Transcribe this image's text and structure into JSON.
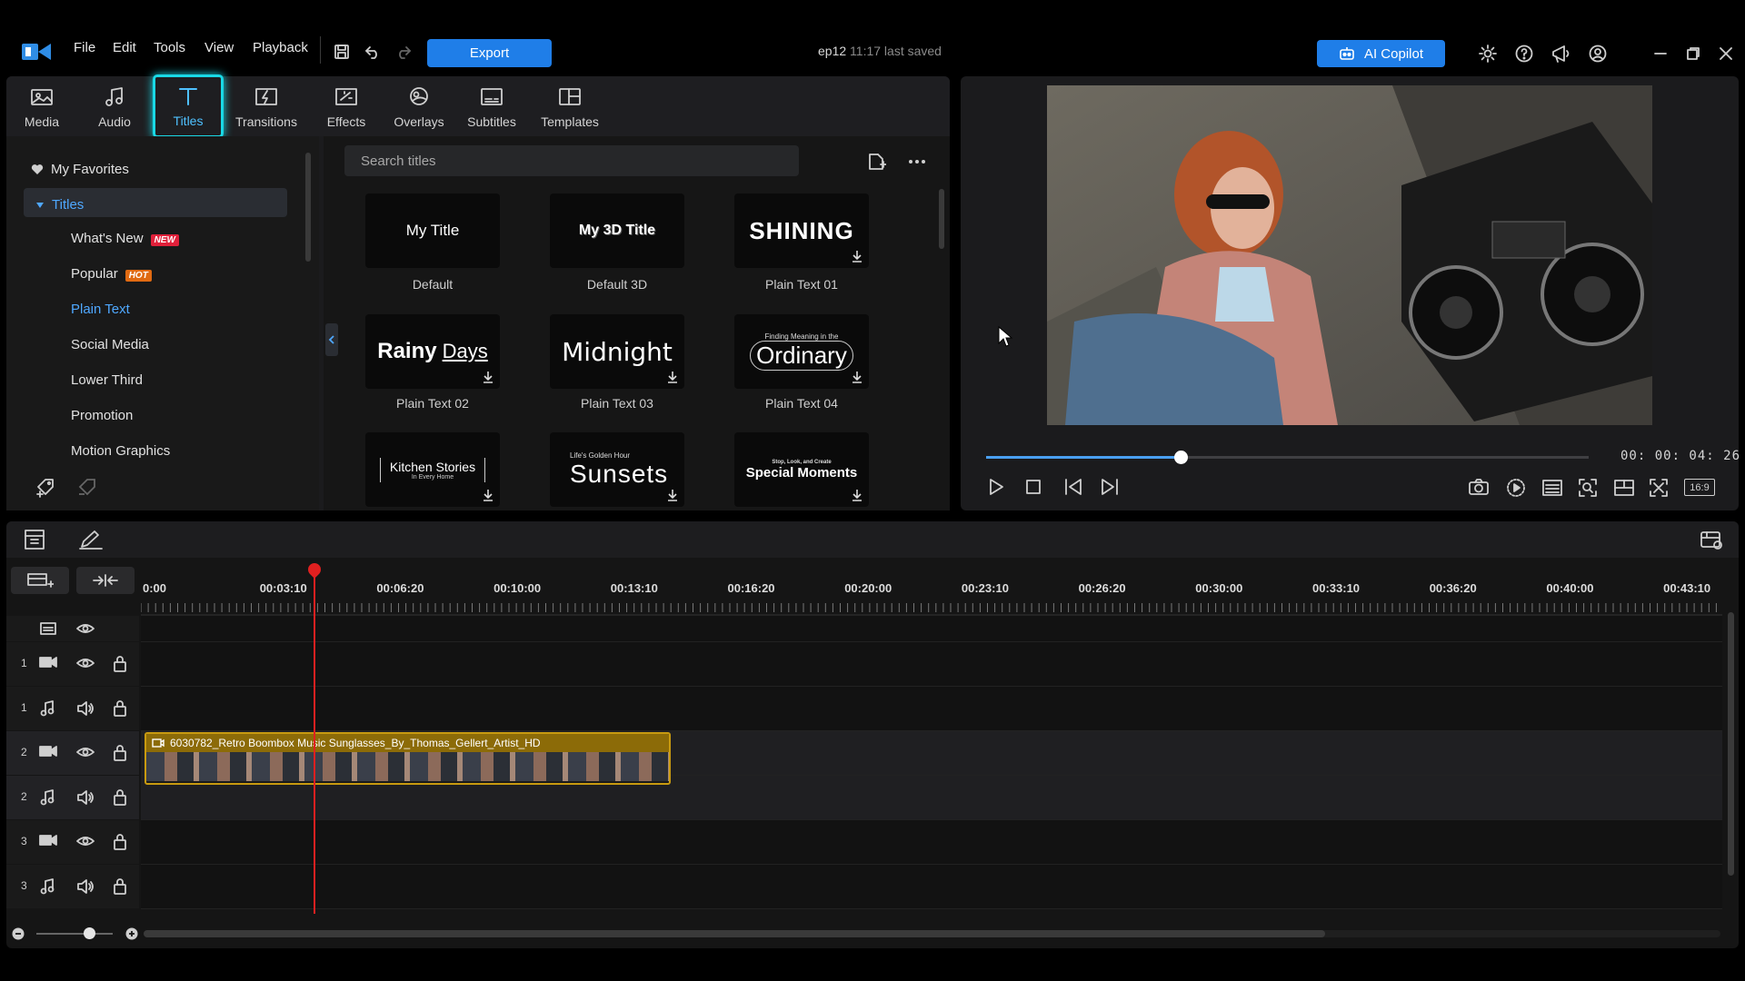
{
  "menu": {
    "items": [
      "File",
      "Edit",
      "Tools",
      "View",
      "Playback"
    ],
    "export_label": "Export",
    "project_name": "ep12",
    "project_status": "11:17 last saved",
    "ai_copilot_label": "AI Copilot"
  },
  "tabs": [
    {
      "label": "Media",
      "icon": "media-icon"
    },
    {
      "label": "Audio",
      "icon": "music-note-icon"
    },
    {
      "label": "Titles",
      "icon": "title-t-icon",
      "active": true
    },
    {
      "label": "Transitions",
      "icon": "transition-icon"
    },
    {
      "label": "Effects",
      "icon": "effects-icon"
    },
    {
      "label": "Overlays",
      "icon": "overlays-icon"
    },
    {
      "label": "Subtitles",
      "icon": "subtitles-icon"
    },
    {
      "label": "Templates",
      "icon": "templates-icon"
    }
  ],
  "categories": {
    "favorites": "My Favorites",
    "group": "Titles",
    "items": [
      {
        "label": "What's New",
        "badge": "NEW",
        "badge_color": "#e0203a"
      },
      {
        "label": "Popular",
        "badge": "HOT",
        "badge_color": "#e06a12"
      },
      {
        "label": "Plain Text",
        "selected": true
      },
      {
        "label": "Social Media"
      },
      {
        "label": "Lower Third"
      },
      {
        "label": "Promotion"
      },
      {
        "label": "Motion Graphics"
      }
    ]
  },
  "search": {
    "placeholder": "Search titles"
  },
  "titles": [
    {
      "preview": "My Title",
      "label": "Default",
      "download": false
    },
    {
      "preview": "My 3D Title",
      "label": "Default 3D",
      "download": false
    },
    {
      "preview": "SHINING",
      "label": "Plain Text 01",
      "download": true
    },
    {
      "preview_a": "Rainy",
      "preview_b": "Days",
      "label": "Plain Text 02",
      "download": true
    },
    {
      "preview": "Midnight",
      "label": "Plain Text 03",
      "download": true
    },
    {
      "preview_small": "Finding Meaning in the",
      "preview": "Ordinary",
      "label": "Plain Text 04",
      "download": true
    },
    {
      "preview": "Kitchen Stories",
      "preview_small": "In Every Home",
      "download": true
    },
    {
      "preview_small": "Life's Golden Hour",
      "preview": "Sunsets",
      "download": true
    },
    {
      "preview_small": "Stop, Look, and Create",
      "preview": "Special Moments",
      "download": true
    }
  ],
  "player": {
    "timecode": "00: 00: 04: 26",
    "progress": 0.326,
    "aspect": "16:9"
  },
  "timeline": {
    "ruler": [
      "0:00",
      "00:03:10",
      "00:06:20",
      "00:10:00",
      "00:13:10",
      "00:16:20",
      "00:20:00",
      "00:23:10",
      "00:26:20",
      "00:30:00",
      "00:33:10",
      "00:36:20",
      "00:40:00",
      "00:43:10"
    ],
    "tracks": [
      {
        "num": "1",
        "type": "video"
      },
      {
        "num": "1",
        "type": "audio"
      },
      {
        "num": "2",
        "type": "video"
      },
      {
        "num": "2",
        "type": "audio"
      },
      {
        "num": "3",
        "type": "video"
      },
      {
        "num": "3",
        "type": "audio"
      }
    ],
    "clip_name": "6030782_Retro Boombox Music Sunglasses_By_Thomas_Gellert_Artist_HD"
  },
  "colors": {
    "accent": "#1f7ee8",
    "active_tab": "#19d9e6",
    "clip": "#c89a10",
    "playhead": "#e02020"
  }
}
